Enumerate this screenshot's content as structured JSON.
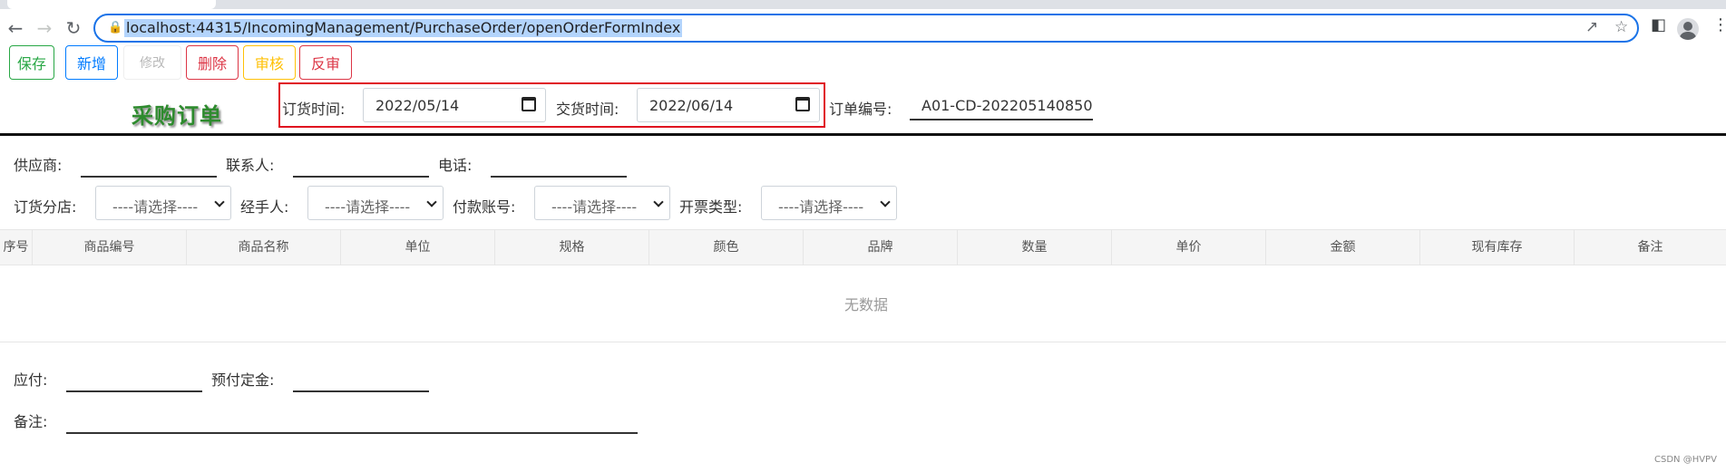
{
  "browser": {
    "url": "localhost:44315/IncomingManagement/PurchaseOrder/openOrderFormIndex"
  },
  "actions": {
    "save": "保存",
    "add": "新增",
    "edit": "修改",
    "delete": "删除",
    "review": "审核",
    "unreview": "反审"
  },
  "form": {
    "title": "采购订单",
    "order_date_label": "订货时间:",
    "order_date_value": "2022/05/14",
    "delivery_date_label": "交货时间:",
    "delivery_date_value": "2022/06/14",
    "order_no_label": "订单编号:",
    "order_no_value": "A01-CD-202205140850",
    "supplier_label": "供应商:",
    "contact_label": "联系人:",
    "phone_label": "电话:",
    "branch_label": "订货分店:",
    "branch_value": "----请选择----",
    "handler_label": "经手人:",
    "handler_value": "----请选择----",
    "pay_account_label": "付款账号:",
    "pay_account_value": "----请选择----",
    "invoice_type_label": "开票类型:",
    "invoice_type_value": "----请选择----"
  },
  "table": {
    "columns": [
      "序号",
      "商品编号",
      "商品名称",
      "单位",
      "规格",
      "颜色",
      "品牌",
      "数量",
      "单价",
      "金额",
      "现有库存",
      "备注"
    ],
    "empty_text": "无数据"
  },
  "footer": {
    "payable_label": "应付:",
    "deposit_label": "预付定金:",
    "remark_label": "备注:"
  },
  "watermark": "CSDN @HVPV"
}
